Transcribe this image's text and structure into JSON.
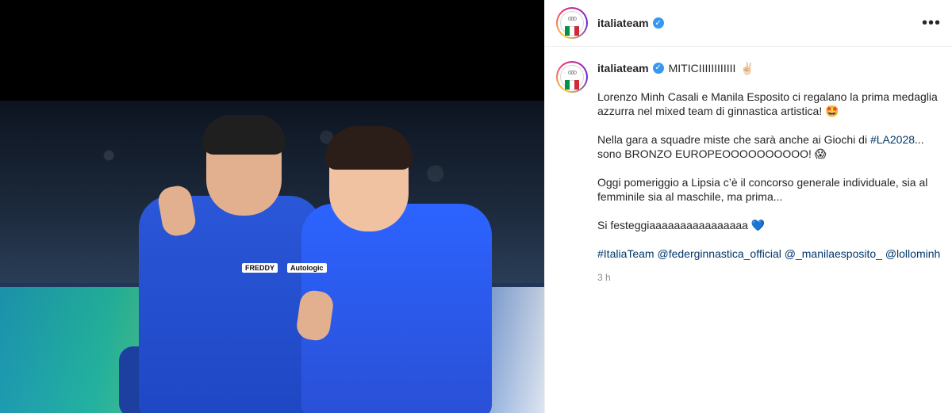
{
  "header": {
    "username": "italiateam",
    "more_icon": "more-horizontal-icon",
    "verified_icon": "verified-badge-icon"
  },
  "post": {
    "author": "italiateam",
    "headline": "MITICIIIIIIIIIIII",
    "headline_emoji": "✌🏻",
    "paragraphs": [
      {
        "text": "Lorenzo Minh Casali e Manila Esposito ci regalano la prima medaglia azzurra nel mixed team di ginnastica artistica! 🤩"
      },
      {
        "prefix": "Nella gara a squadre miste che sarà anche ai Giochi di ",
        "hashtag": "#LA2028",
        "suffix": "... sono BRONZO EUROPEOOOOOOOOOO! 😱"
      },
      {
        "text": "Oggi pomeriggio a Lipsia c’è il concorso generale individuale, sia al femminile sia al maschile, ma prima..."
      },
      {
        "text": "Si festeggiaaaaaaaaaaaaaaaa 💙"
      }
    ],
    "tags": [
      "#ItaliaTeam",
      "@federginnastica_official",
      "@_manilaesposito_",
      "@lollominh"
    ],
    "timestamp": "3 h"
  },
  "media": {
    "jersey_tag_1": "FREDDY",
    "jersey_tag_2": "Autologic",
    "icon": "photo-gymnasts"
  },
  "colors": {
    "link": "#00376b",
    "verified": "#3897f0",
    "flag_green": "#009246",
    "flag_white": "#ffffff",
    "flag_red": "#ce2b37"
  }
}
